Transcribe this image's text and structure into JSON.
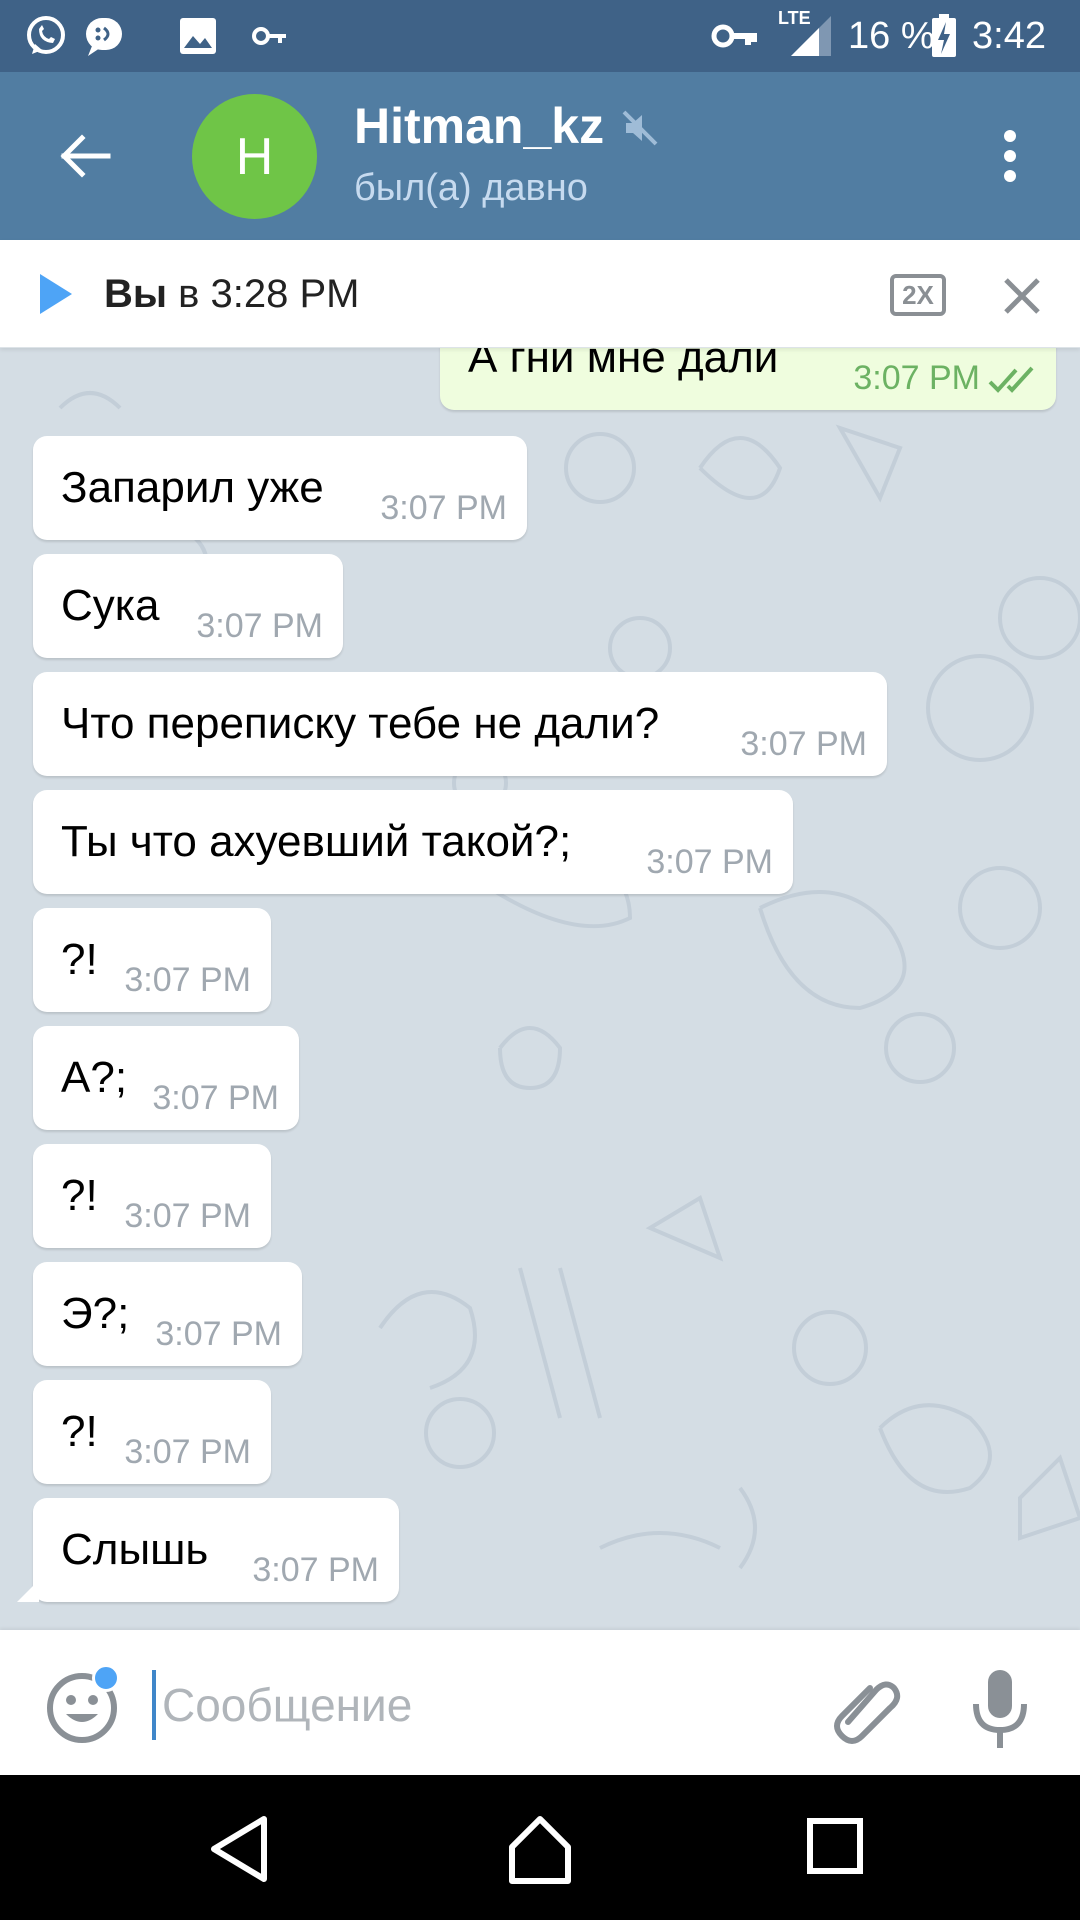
{
  "status_bar": {
    "icons": [
      "whatsapp-icon",
      "chat-icon",
      "image-icon",
      "key-icon"
    ],
    "right_icons": [
      "vpn-key-icon",
      "signal-icon",
      "battery-icon"
    ],
    "network": "LTE",
    "battery": "16 %",
    "time": "3:42"
  },
  "app_bar": {
    "avatar_letter": "H",
    "avatar_color": "#6fc547",
    "title": "Hitman_kz",
    "status": "был(а) давно",
    "muted": true
  },
  "player": {
    "sender": "Вы",
    "rest": " в 3:28 PM",
    "speed_label": "2X"
  },
  "messages": [
    {
      "direction": "out",
      "text": "А гни мне дали",
      "time": "3:07 PM",
      "read": true
    },
    {
      "direction": "in",
      "text": "Запарил уже",
      "time": "3:07 PM"
    },
    {
      "direction": "in",
      "text": "Сука",
      "time": "3:07 PM"
    },
    {
      "direction": "in",
      "text": "Что переписку тебе не дали?",
      "time": "3:07 PM"
    },
    {
      "direction": "in",
      "text": "Ты что ахуевший такой?;",
      "time": "3:07 PM"
    },
    {
      "direction": "in",
      "text": "?!",
      "time": "3:07 PM"
    },
    {
      "direction": "in",
      "text": "А?;",
      "time": "3:07 PM"
    },
    {
      "direction": "in",
      "text": "?!",
      "time": "3:07 PM"
    },
    {
      "direction": "in",
      "text": "Э?;",
      "time": "3:07 PM"
    },
    {
      "direction": "in",
      "text": "?!",
      "time": "3:07 PM"
    },
    {
      "direction": "in",
      "text": "Слышь",
      "time": "3:07 PM"
    }
  ],
  "input": {
    "placeholder": "Сообщение",
    "value": ""
  },
  "colors": {
    "status_bar": "#3f6287",
    "app_bar": "#517da2",
    "chat_background": "#d4dde4",
    "outgoing_bubble": "#effdde",
    "outgoing_time": "#6cb263",
    "accent": "#4ea4f6"
  }
}
